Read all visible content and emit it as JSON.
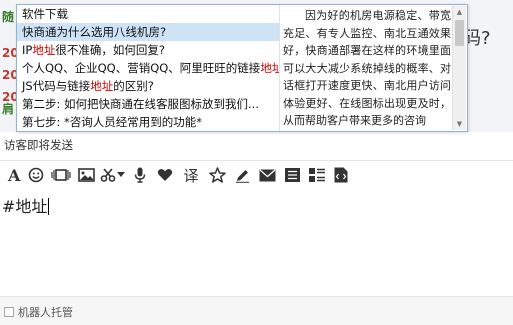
{
  "background": {
    "left_fragments": [
      {
        "text": "随",
        "color": "#3a7d2b"
      },
      {
        "text": "20",
        "color": "#c0392b"
      },
      {
        "text": "20",
        "color": "#c0392b"
      },
      {
        "text": "20",
        "color": "#c0392b"
      },
      {
        "text": "肩",
        "color": "#3a7d2b"
      }
    ],
    "right_fragment": "码?"
  },
  "popup": {
    "items": [
      {
        "before": "软件下载",
        "highlight": "",
        "after": ""
      },
      {
        "before": "快商通为什么选用八线机房?",
        "highlight": "",
        "after": ""
      },
      {
        "before": "IP",
        "highlight": "地址",
        "after": "很不准确，如何回复?"
      },
      {
        "before": "个人QQ、企业QQ、营销QQ、阿里旺旺的链接",
        "highlight": "地址",
        "after": ""
      },
      {
        "before": "JS代码与链接",
        "highlight": "地址",
        "after": "的区别?"
      },
      {
        "before": "第二步: 如何把快商通在线客服图标放到我们...",
        "highlight": "",
        "after": ""
      },
      {
        "before": "第七步: *咨询人员经常用到的功能*",
        "highlight": "",
        "after": ""
      }
    ],
    "selected_index": 1,
    "description": "因为好的机房电源稳定、带宽充足、有专人监控、南北互通效果好，快商通部署在这样的环境里面可以大大减少系统掉线的概率、对话框打开速度更快、南北用户访问体验更好、在线图标出现更及时，从而帮助客户带来更多的咨询"
  },
  "status": {
    "text": "访客即将发送"
  },
  "toolbar": {
    "icons": [
      "font-icon",
      "emoji-icon",
      "screenshot-icon",
      "image-icon",
      "scissors-icon",
      "dropdown-arrow-icon",
      "microphone-icon",
      "heart-icon",
      "translate-icon",
      "star-icon",
      "pen-icon",
      "email-icon",
      "list-icon",
      "grid-list-icon",
      "code-file-icon"
    ],
    "translate_glyph": "译"
  },
  "input": {
    "value": "#地址"
  },
  "footer": {
    "robot_label": "机器人托管"
  }
}
